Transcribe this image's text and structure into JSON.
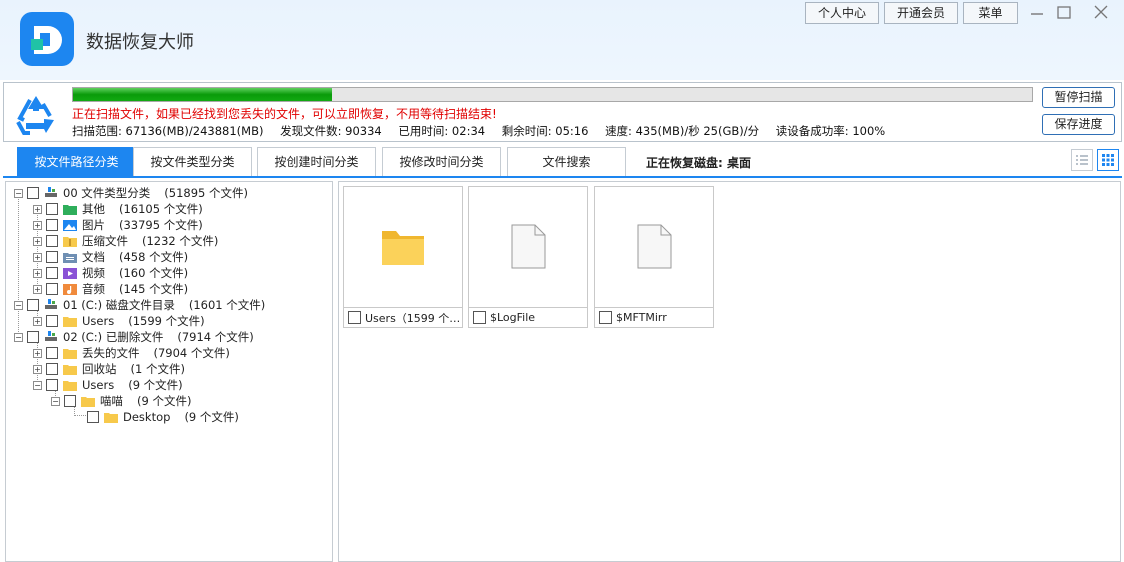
{
  "app": {
    "title": "数据恢复大师",
    "accent": "#1d86f0"
  },
  "topbar": {
    "personal_center": "个人中心",
    "vip": "开通会员",
    "menu": "菜单"
  },
  "scan": {
    "progress": 0.27,
    "message": "正在扫描文件，如果已经找到您丢失的文件，可以立即恢复，不用等待扫描结束!",
    "range": "扫描范围: 67136(MB)/243881(MB)",
    "found": "发现文件数: 90334",
    "elapsed": "已用时间: 02:34",
    "remaining": "剩余时间: 05:16",
    "speed": "速度: 435(MB)/秒  25(GB)/分",
    "success_rate": "读设备成功率: 100%",
    "pause_button": "暂停扫描",
    "save_button": "保存进度"
  },
  "tabs": [
    {
      "label": "按文件路径分类",
      "active": true
    },
    {
      "label": "按文件类型分类",
      "active": false
    },
    {
      "label": "按创建时间分类",
      "active": false
    },
    {
      "label": "按修改时间分类",
      "active": false
    },
    {
      "label": "文件搜索",
      "active": false
    }
  ],
  "disk_status": "正在恢复磁盘: 桌面",
  "tree": [
    {
      "id": "type-root",
      "label": "00 文件类型分类",
      "count": "(51895 个文件)",
      "icon": "drive-icon"
    },
    {
      "id": "other",
      "label": "其他",
      "count": "(16105 个文件)",
      "icon": "folder-green-icon"
    },
    {
      "id": "images",
      "label": "图片",
      "count": "(33795 个文件)",
      "icon": "picture-icon"
    },
    {
      "id": "archives",
      "label": "压缩文件",
      "count": "(1232 个文件)",
      "icon": "archive-folder-icon"
    },
    {
      "id": "docs",
      "label": "文档",
      "count": "(458 个文件)",
      "icon": "document-folder-icon"
    },
    {
      "id": "video",
      "label": "视频",
      "count": "(160 个文件)",
      "icon": "video-folder-icon"
    },
    {
      "id": "audio",
      "label": "音频",
      "count": "(145 个文件)",
      "icon": "audio-folder-icon"
    },
    {
      "id": "dir-root",
      "label": "01 (C:) 磁盘文件目录",
      "count": "(1601 个文件)",
      "icon": "drive-icon"
    },
    {
      "id": "users1",
      "label": "Users",
      "count": "(1599 个文件)",
      "icon": "folder-icon"
    },
    {
      "id": "deleted-root",
      "label": "02 (C:) 已删除文件",
      "count": "(7914 个文件)",
      "icon": "drive-icon"
    },
    {
      "id": "lost",
      "label": "丢失的文件",
      "count": "(7904 个文件)",
      "icon": "folder-icon"
    },
    {
      "id": "recycle",
      "label": "回收站",
      "count": "(1 个文件)",
      "icon": "folder-icon"
    },
    {
      "id": "users2",
      "label": "Users",
      "count": "(9 个文件)",
      "icon": "folder-icon"
    },
    {
      "id": "miaomiao",
      "label": "喵喵",
      "count": "(9 个文件)",
      "icon": "folder-icon"
    },
    {
      "id": "desktop",
      "label": "Desktop",
      "count": "(9 个文件)",
      "icon": "folder-icon"
    }
  ],
  "files": [
    {
      "name": "Users（1599 个…",
      "icon": "folder-icon"
    },
    {
      "name": "$LogFile",
      "icon": "file-icon"
    },
    {
      "name": "$MFTMirr",
      "icon": "file-icon"
    }
  ]
}
